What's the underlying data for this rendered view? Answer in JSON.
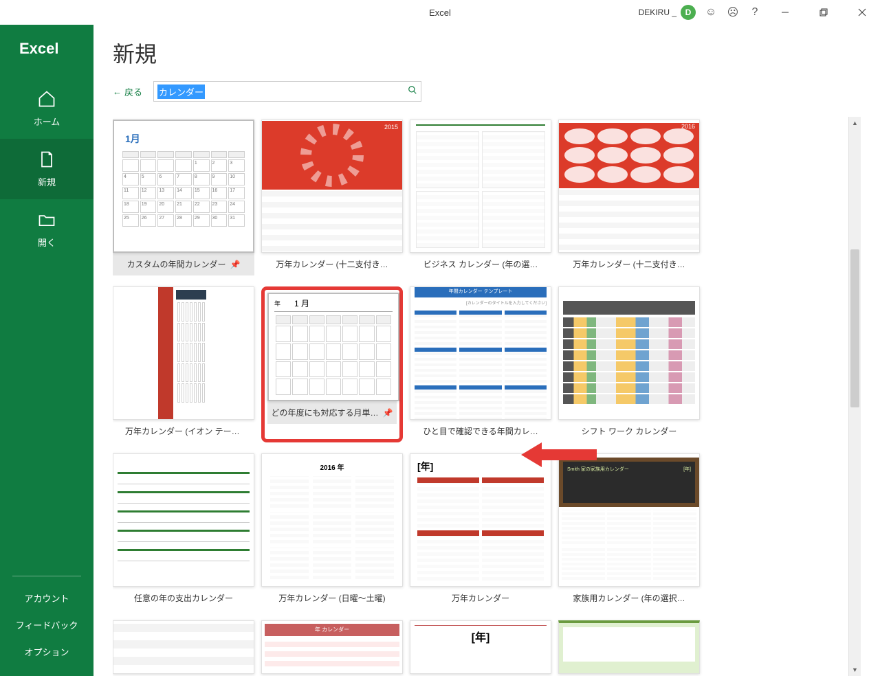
{
  "titlebar": {
    "app_title": "Excel",
    "user_name": "DEKIRU _",
    "avatar_initial": "D"
  },
  "sidebar": {
    "logo": "Excel",
    "items": [
      {
        "label": "ホーム",
        "icon": "home"
      },
      {
        "label": "新規",
        "icon": "new"
      },
      {
        "label": "開く",
        "icon": "open"
      }
    ],
    "footer": {
      "account": "アカウント",
      "feedback": "フィードバック",
      "options": "オプション"
    }
  },
  "content": {
    "heading": "新規",
    "back_label": "戻る",
    "search_value": "カレンダー"
  },
  "templates": [
    {
      "title": "カスタムの年間カレンダー",
      "pinned": true,
      "hover": true
    },
    {
      "title": "万年カレンダー (十二支付き…",
      "year2015": "2015"
    },
    {
      "title": "ビジネス カレンダー (年の選…"
    },
    {
      "title": "万年カレンダー (十二支付き…",
      "year2016": "2016"
    },
    {
      "title": "万年カレンダー (イオン テーマ)"
    },
    {
      "title": "どの年度にも対応する月単…",
      "pinned": true,
      "highlighted": true,
      "month_label": "1 月",
      "year_label": "年"
    },
    {
      "title": "ひと目で確認できる年間カレ…",
      "header_text": "年間カレンダー テンプレート"
    },
    {
      "title": "シフト ワーク カレンダー"
    },
    {
      "title": "任意の年の支出カレンダー"
    },
    {
      "title": "万年カレンダー (日曜～土曜)",
      "year_text": "2016 年"
    },
    {
      "title": "万年カレンダー",
      "year_text": "[年]"
    },
    {
      "title": "家族用カレンダー (年の選択…",
      "board_text": "Smith 家の家族用カレンダー",
      "board_right": "[年]"
    }
  ],
  "partial_row": [
    {},
    {
      "head": "年 カレンダー"
    },
    {
      "year": "[年]"
    },
    {}
  ],
  "month1": "1月"
}
